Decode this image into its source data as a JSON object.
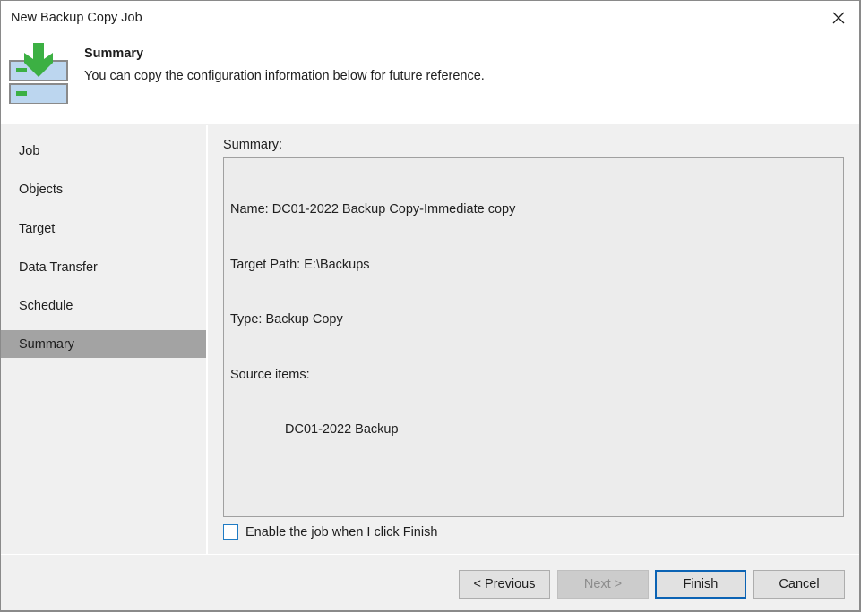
{
  "window": {
    "title": "New Backup Copy Job",
    "close_icon": "close-icon"
  },
  "header": {
    "icon": "backup-copy-download-icon",
    "title": "Summary",
    "description": "You can copy the configuration information below for future reference."
  },
  "sidebar": {
    "items": [
      {
        "label": "Job",
        "active": false
      },
      {
        "label": "Objects",
        "active": false
      },
      {
        "label": "Target",
        "active": false
      },
      {
        "label": "Data Transfer",
        "active": false
      },
      {
        "label": "Schedule",
        "active": false
      },
      {
        "label": "Summary",
        "active": true
      }
    ]
  },
  "main": {
    "summary_label": "Summary:",
    "summary_lines": [
      "Name: DC01-2022 Backup Copy-Immediate copy",
      "Target Path: E:\\Backups",
      "Type: Backup Copy",
      "Source items:",
      "DC01-2022 Backup"
    ],
    "enable_checkbox": {
      "label": "Enable the job when I click Finish",
      "checked": false
    }
  },
  "footer": {
    "previous_label": "< Previous",
    "next_label": "Next >",
    "finish_label": "Finish",
    "cancel_label": "Cancel"
  },
  "colors": {
    "active_nav_bg": "#a3a3a3",
    "default_button_border": "#0b63b4",
    "checkbox_border": "#1f7bc4",
    "icon_green": "#3cb043",
    "icon_blue": "#bcd6ef"
  }
}
